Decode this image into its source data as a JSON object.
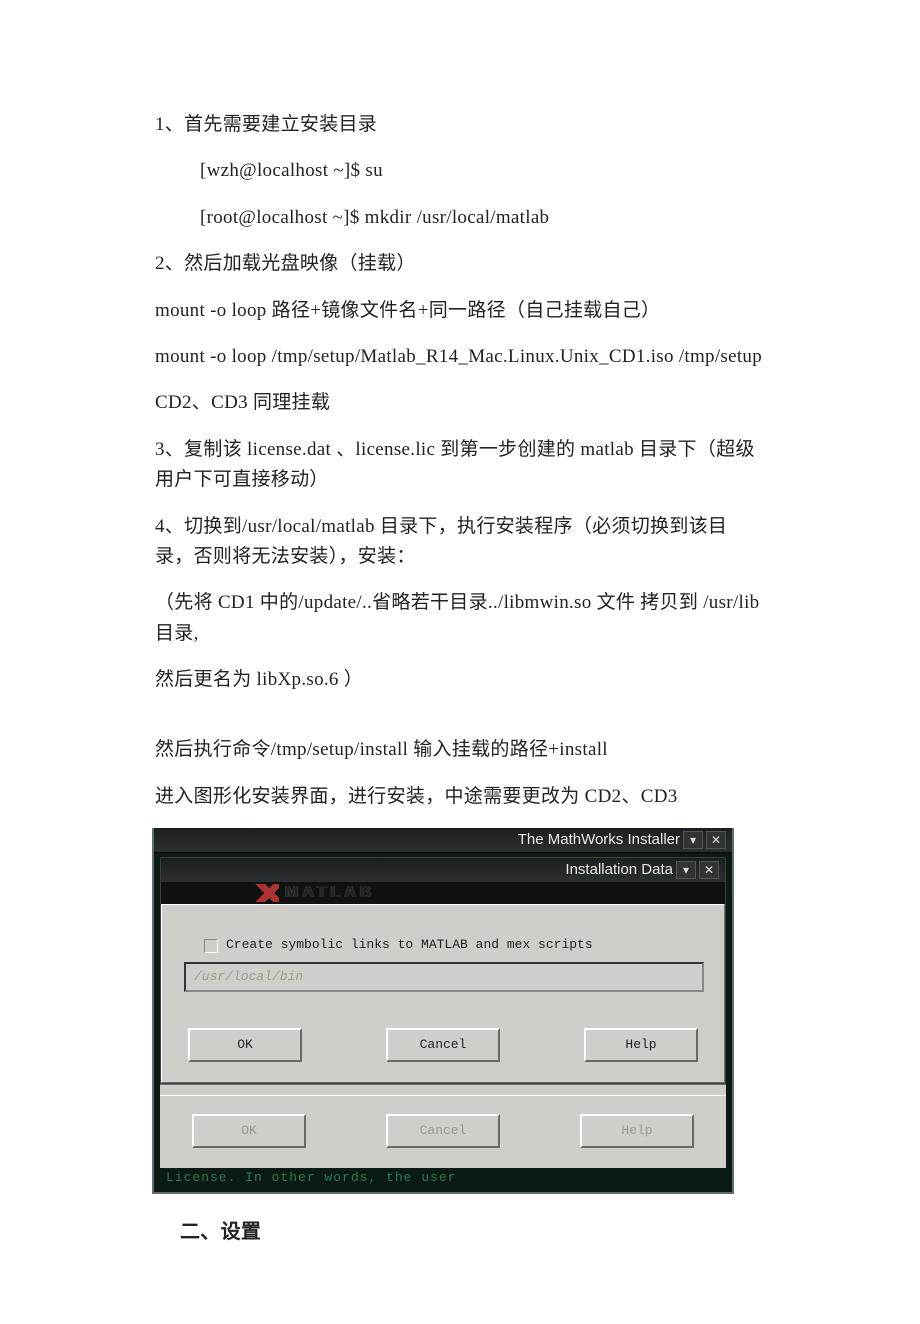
{
  "doc": {
    "p1": "1、首先需要建立安装目录",
    "p2": "[wzh@localhost ~]$ su",
    "p3": "[root@localhost ~]$ mkdir /usr/local/matlab",
    "p4": "2、然后加载光盘映像（挂载）",
    "p5": "mount -o loop 路径+镜像文件名+同一路径（自己挂载自己）",
    "p6": "mount -o loop /tmp/setup/Matlab_R14_Mac.Linux.Unix_CD1.iso /tmp/setup",
    "p7": "CD2、CD3 同理挂载",
    "p8": "3、复制该 license.dat 、license.lic 到第一步创建的 matlab 目录下（超级用户下可直接移动）",
    "p9": "4、切换到/usr/local/matlab 目录下，执行安装程序（必须切换到该目录，否则将无法安装），安装：",
    "p10": "（先将 CD1 中的/update/..省略若干目录../libmwin.so 文件 拷贝到 /usr/lib 目录,",
    "p11": "然后更名为 libXp.so.6 ）",
    "p12": "然后执行命令/tmp/setup/install 输入挂载的路径+install",
    "p13": "进入图形化安装界面，进行安装，中途需要更改为 CD2、CD3",
    "heading2": "二、设置"
  },
  "installer": {
    "outer_title": "The MathWorks Installer",
    "inner_title": "Installation Data",
    "banner_text": "MATLAB",
    "checkbox_label": "Create symbolic links to MATLAB and mex scripts",
    "path_value": "/usr/local/bin",
    "buttons": {
      "ok": "OK",
      "cancel": "Cancel",
      "help": "Help",
      "ok2": "OK",
      "cancel2": "Cancel",
      "help2": "Help"
    },
    "tb_min": "▾",
    "tb_close": "✕",
    "terminal_fragment": "License.   In  other  words,  the  user"
  }
}
